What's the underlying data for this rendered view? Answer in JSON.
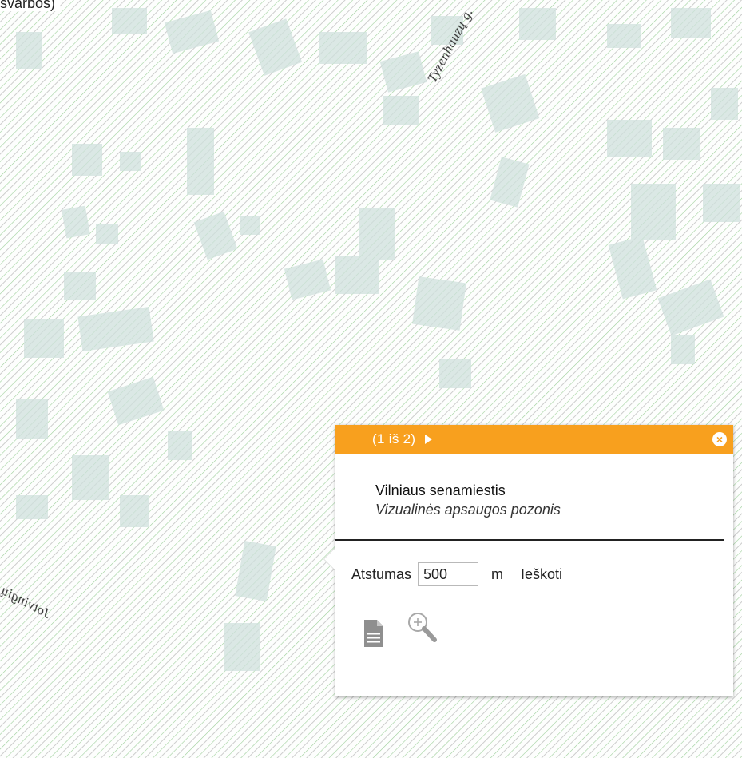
{
  "corner_text": "svarbos)",
  "streets": {
    "top_right": "Tyzenhauzų g.",
    "bottom_left": "Jotvingių g."
  },
  "popup": {
    "pager": "(1 iš 2)",
    "next_icon": "play-arrow-icon",
    "close_icon": "close-circle-icon",
    "title": "Vilniaus senamiestis",
    "subtitle": "Vizualinės apsaugos pozonis",
    "distance_label": "Atstumas",
    "distance_value": "500",
    "distance_unit": "m",
    "search_label": "Ieškoti",
    "doc_icon": "document-icon",
    "zoom_icon": "zoom-in-icon"
  },
  "colors": {
    "header": "#f8a01e",
    "hatch": "#9fd09a",
    "building": "#d6e4e0"
  }
}
